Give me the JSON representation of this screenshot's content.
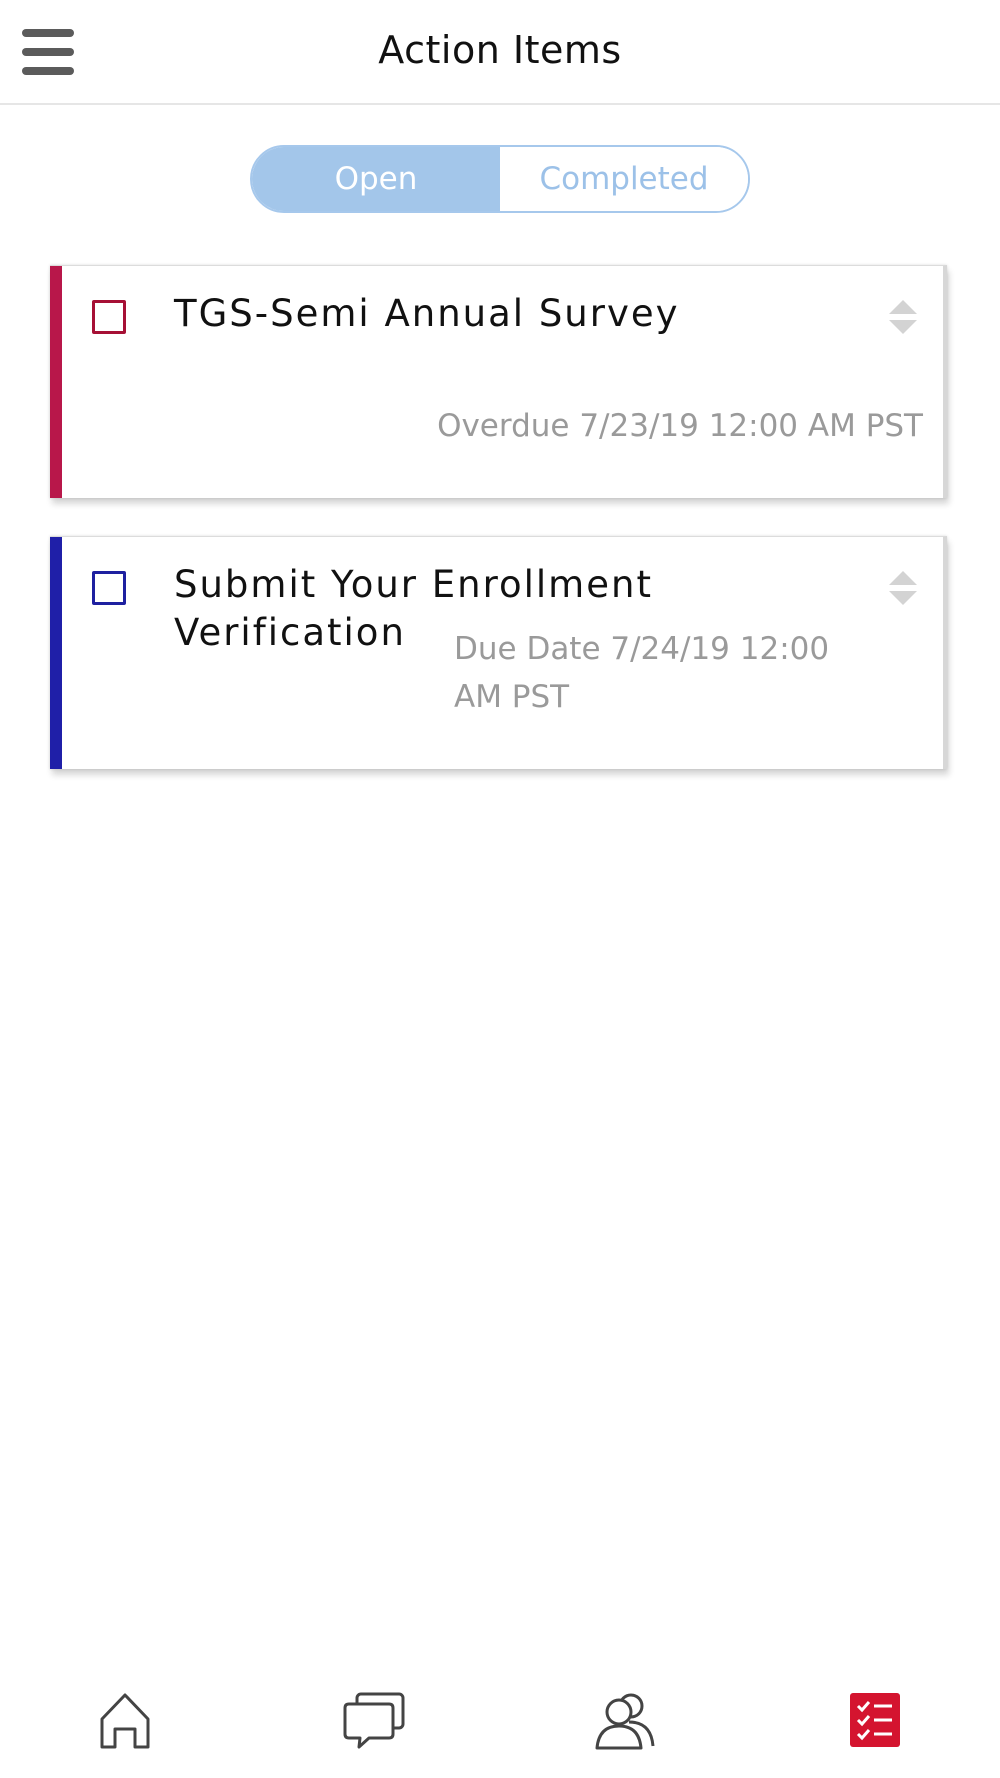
{
  "header": {
    "title": "Action Items",
    "menu_icon": "hamburger-menu-icon"
  },
  "tabs": {
    "open_label": "Open",
    "completed_label": "Completed",
    "active": "Open"
  },
  "action_items": [
    {
      "title": "TGS-Semi Annual Survey",
      "due_text": "Overdue 7/23/19 12:00 AM PST",
      "accent_color": "#b8174a",
      "checked": false
    },
    {
      "title": "Submit Your Enrollment Verification",
      "due_text": "Due Date 7/24/19 12:00 AM PST",
      "accent_color": "#1f1fa8",
      "checked": false
    }
  ],
  "bottom_nav": {
    "items": [
      {
        "icon": "home-icon",
        "active": false
      },
      {
        "icon": "chat-icon",
        "active": false
      },
      {
        "icon": "people-icon",
        "active": false
      },
      {
        "icon": "checklist-icon",
        "active": true
      }
    ],
    "active_color": "#d4142f",
    "inactive_color": "#444444"
  },
  "colors": {
    "segment_active_bg": "#a3c6ea",
    "segment_border": "#a6c8ec",
    "due_text": "#9a9a9a"
  }
}
